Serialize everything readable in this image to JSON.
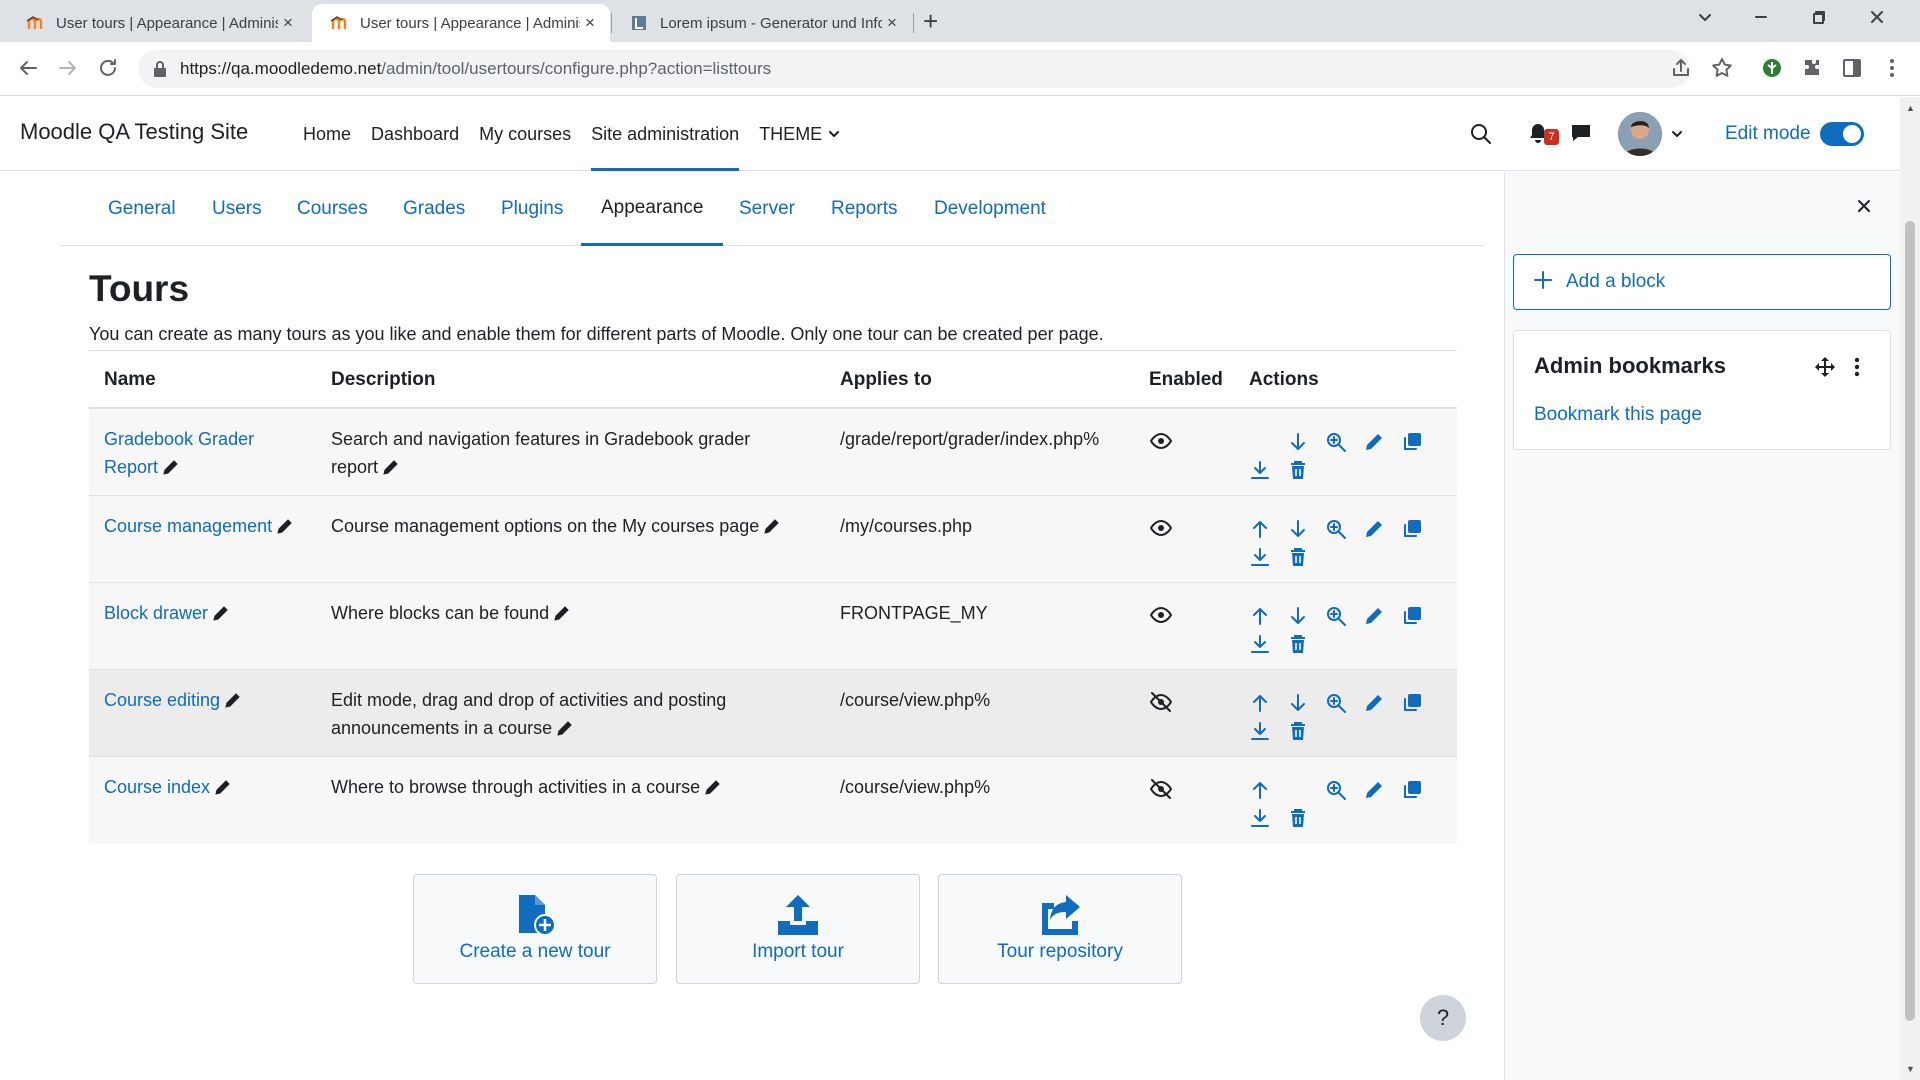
{
  "browser": {
    "tabs": [
      {
        "title": "User tours | Appearance | Administ",
        "close": "×",
        "active": false
      },
      {
        "title": "User tours | Appearance | Administ",
        "close": "×",
        "active": true
      },
      {
        "title": "Lorem ipsum - Generator und Info",
        "close": "×",
        "active": false
      }
    ],
    "new_tab": "+",
    "url_host": "https://qa.moodledemo.net",
    "url_path": "/admin/tool/usertours/configure.php?action=listtours"
  },
  "navbar": {
    "brand": "Moodle QA Testing Site",
    "items": [
      "Home",
      "Dashboard",
      "My courses",
      "Site administration",
      "THEME"
    ],
    "active_index": 3,
    "notification_count": "7",
    "edit_mode_label": "Edit mode",
    "edit_mode_on": true
  },
  "secondary_nav": {
    "items": [
      "General",
      "Users",
      "Courses",
      "Grades",
      "Plugins",
      "Appearance",
      "Server",
      "Reports",
      "Development"
    ],
    "active_index": 5
  },
  "page": {
    "title": "Tours",
    "intro": "You can create as many tours as you like and enable them for different parts of Moodle. Only one tour can be created per page."
  },
  "table": {
    "headers": [
      "Name",
      "Description",
      "Applies to",
      "Enabled",
      "Actions"
    ],
    "rows": [
      {
        "name": "Gradebook Grader Report",
        "description": "Search and navigation features in Gradebook grader report",
        "applies_to": "/grade/report/grader/index.php%",
        "enabled": true
      },
      {
        "name": "Course management",
        "description": "Course management options on the My courses page",
        "applies_to": "/my/courses.php",
        "enabled": true
      },
      {
        "name": "Block drawer",
        "description": "Where blocks can be found",
        "applies_to": "FRONTPAGE_MY",
        "enabled": true
      },
      {
        "name": "Course editing",
        "description": "Edit mode, drag and drop of activities and posting announcements in a course",
        "applies_to": "/course/view.php%",
        "enabled": false
      },
      {
        "name": "Course index",
        "description": "Where to browse through activities in a course",
        "applies_to": "/course/view.php%",
        "enabled": false
      }
    ]
  },
  "buttons": {
    "create": "Create a new tour",
    "import": "Import tour",
    "repository": "Tour repository"
  },
  "help": "?",
  "drawer": {
    "add_block": "Add a block",
    "block_title": "Admin bookmarks",
    "bookmark_link": "Bookmark this page"
  },
  "colors": {
    "accent": "#0f6cbf",
    "text": "#1d2125",
    "notification_badge": "#ca3120"
  }
}
